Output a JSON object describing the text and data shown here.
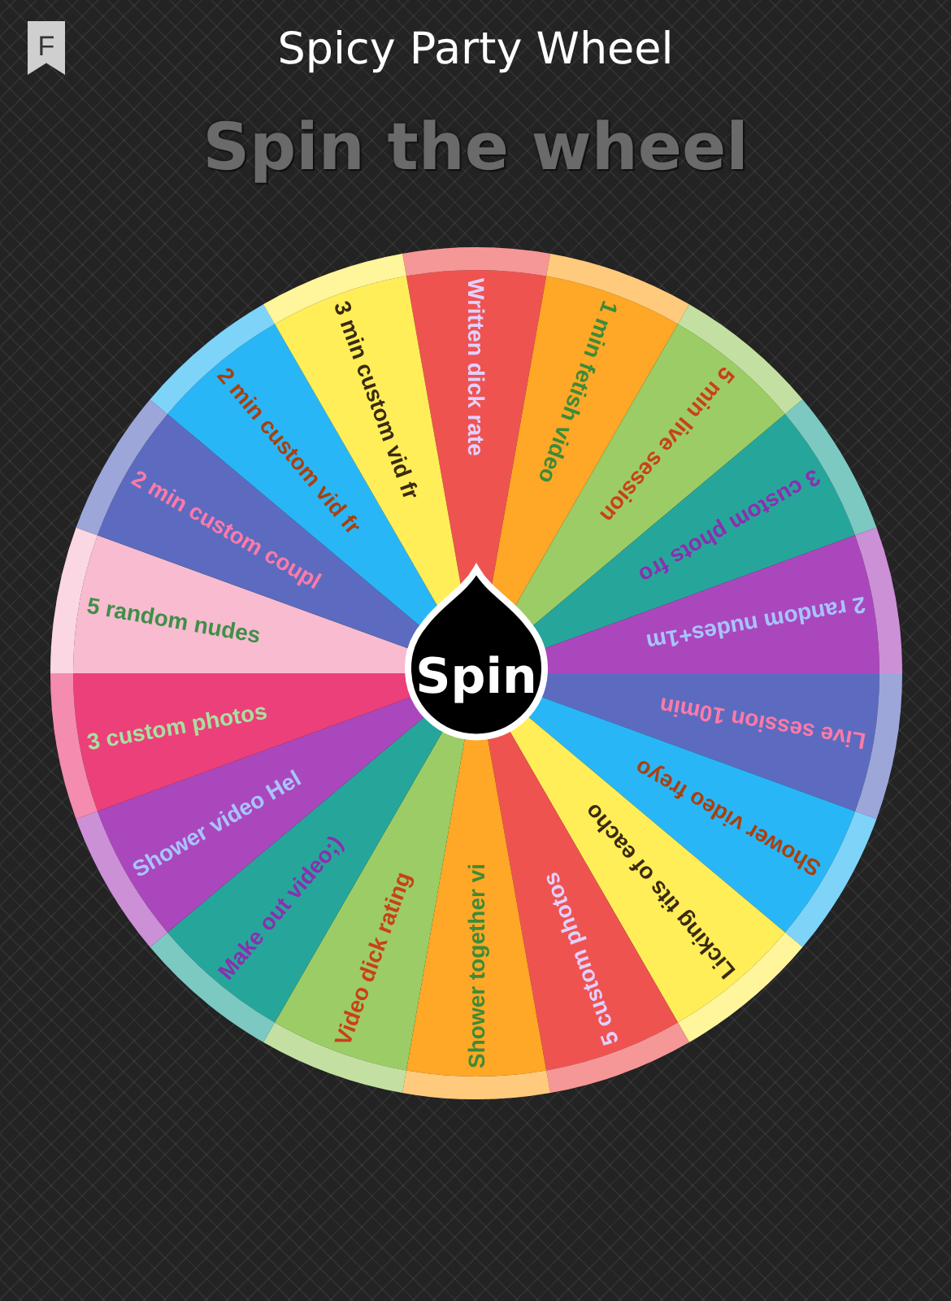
{
  "header": {
    "logo_letter": "F",
    "title": "Spicy Party Wheel"
  },
  "heading": "Spin the wheel",
  "wheel": {
    "spin_label": "Spin",
    "segments": [
      {
        "label": "Written dick rate",
        "color": "#ef5350"
      },
      {
        "label": "1 min fetish video",
        "color": "#ffa726"
      },
      {
        "label": "5 min live session",
        "color": "#9ccc65"
      },
      {
        "label": "3 custom phots fro",
        "color": "#26a69a"
      },
      {
        "label": "2 random nudes+1m",
        "color": "#ab47bc"
      },
      {
        "label": "Live session 10min",
        "color": "#5c6bc0"
      },
      {
        "label": "Shower video freyo",
        "color": "#29b6f6"
      },
      {
        "label": "Licking tits of eacho",
        "color": "#ffee58"
      },
      {
        "label": "5 custom photos",
        "color": "#ef5350"
      },
      {
        "label": "Shower together vi",
        "color": "#ffa726"
      },
      {
        "label": "Video dick rating",
        "color": "#9ccc65"
      },
      {
        "label": "Make out video;)",
        "color": "#26a69a"
      },
      {
        "label": "Shower video Hel",
        "color": "#ab47bc"
      },
      {
        "label": "3 custom photos",
        "color": "#ec407a"
      },
      {
        "label": "5 random nudes",
        "color": "#f8bbd0"
      },
      {
        "label": "2 min custom coupl",
        "color": "#5c6bc0"
      },
      {
        "label": "2 min custom vid fr",
        "color": "#29b6f6"
      },
      {
        "label": "3 min custom vid fr",
        "color": "#ffee58"
      }
    ]
  }
}
